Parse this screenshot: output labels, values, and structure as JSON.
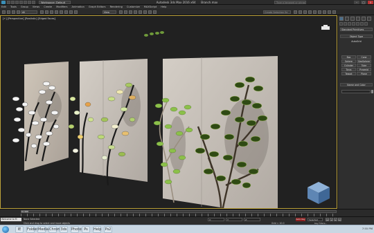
{
  "window": {
    "title": "Autodesk 3ds Max 2016 x64",
    "file": "Branch.max",
    "workspace": "Workspace: Default",
    "search_placeholder": "Type a keyword or phrase"
  },
  "menu": [
    "Edit",
    "Tools",
    "Group",
    "Views",
    "Create",
    "Modifiers",
    "Animation",
    "Graph Editors",
    "Rendering",
    "Customize",
    "MAXScript",
    "Help"
  ],
  "toolbar": {
    "selection_filter": "All",
    "reference_coord": "View",
    "named_selection_placeholder": "Create Selection Se"
  },
  "viewport": {
    "label": "[+] [Perspective] [Realistic] [Edged Faces]"
  },
  "command_panel": {
    "category": "Standard Primitives",
    "rollout_object_type": "Object Type",
    "autogrid": "AutoGrid",
    "buttons": [
      "Box",
      "Cone",
      "Sphere",
      "GeoSphere",
      "Cylinder",
      "Tube",
      "Torus",
      "Pyramid",
      "Teapot",
      "Plane"
    ],
    "rollout_name_color": "Name and Color"
  },
  "timeline": {
    "frame_display": "0 / 100"
  },
  "status": {
    "maxscript_listener": "Welcome to M",
    "selection_status": "None Selected",
    "prompt": "Click and drag to select and move objects",
    "x_label": "X:",
    "y_label": "Y:",
    "z_label": "Z:",
    "grid": "Grid = 10.0",
    "auto_key": "Auto Key",
    "selected_dropdown": "Selected",
    "set_key": "Set Key",
    "key_filters": "Key Filters..."
  },
  "taskbar": {
    "apps": [
      "IE",
      "Folder",
      "Media",
      "Chrome",
      "3ds",
      "Photos",
      "Ps",
      "Help",
      "Ps2"
    ],
    "time": "7:55 PM"
  },
  "colors": {
    "viewport_border": "#bca23a",
    "auto_key": "#8b1f1f"
  }
}
